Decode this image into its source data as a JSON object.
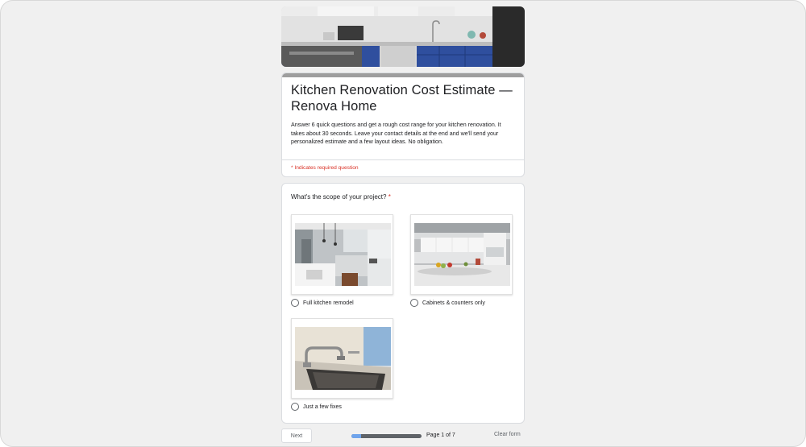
{
  "form": {
    "title": "Kitchen Renovation Cost Estimate — Renova Home",
    "description": "Answer 6 quick questions and get a rough cost range for your kitchen renovation. It takes about 30 seconds. Leave your contact details at the end and we'll send your personalized estimate and a few layout ideas. No obligation.",
    "required_note": "* Indicates required question"
  },
  "question": {
    "text": "What's the scope of your project?",
    "required_mark": "*",
    "options": [
      {
        "label": "Full kitchen remodel",
        "image_icon": "kitchen-photo-icon"
      },
      {
        "label": "Cabinets & counters only",
        "image_icon": "cabinets-photo-icon"
      },
      {
        "label": "Just a few fixes",
        "image_icon": "faucet-photo-icon"
      }
    ]
  },
  "footer": {
    "next_label": "Next",
    "page_text": "Page 1 of 7",
    "progress_fraction": 0.143,
    "clear_label": "Clear form"
  },
  "colors": {
    "accent": "#6fa4ec",
    "required": "#d93025",
    "cabinet_blue": "#2f4f9e"
  }
}
